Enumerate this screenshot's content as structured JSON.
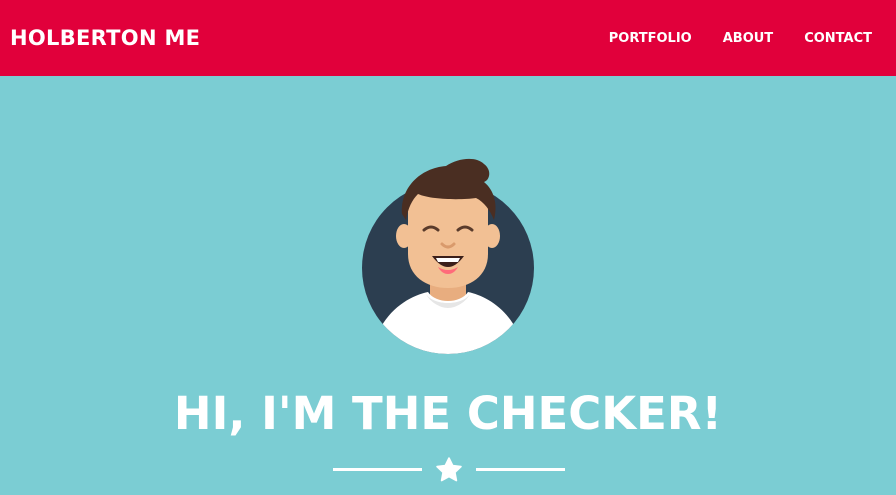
{
  "navbar": {
    "brand": "HOLBERTON ME",
    "links": [
      {
        "label": "PORTFOLIO"
      },
      {
        "label": "ABOUT"
      },
      {
        "label": "CONTACT"
      }
    ]
  },
  "hero": {
    "title": "HI, I'M THE CHECKER!",
    "avatar_icon": "avatar-illustration",
    "divider_icon": "star-icon"
  },
  "colors": {
    "navbar_bg": "#e1003b",
    "hero_bg": "#7bcdd3",
    "text": "#ffffff",
    "avatar_circle": "#2c3e50"
  }
}
